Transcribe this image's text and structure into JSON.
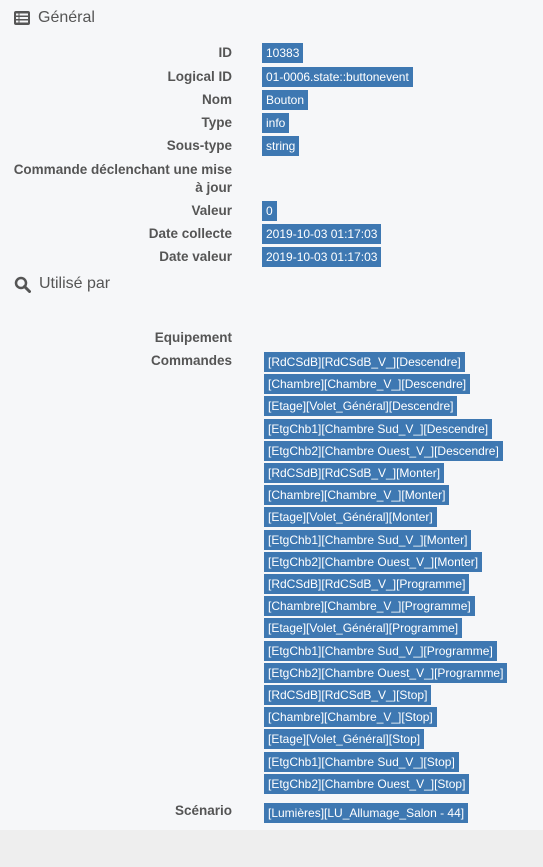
{
  "general": {
    "title": "Général",
    "icon": "list-icon",
    "rows": [
      {
        "label": "ID",
        "value": "10383"
      },
      {
        "label": "Logical ID",
        "value": "01-0006.state::buttonevent"
      },
      {
        "label": "Nom",
        "value": "Bouton"
      },
      {
        "label": "Type",
        "value": "info"
      },
      {
        "label": "Sous-type",
        "value": "string"
      },
      {
        "label": "Commande déclenchant une mise à jour",
        "value": ""
      },
      {
        "label": "Valeur",
        "value": "0"
      },
      {
        "label": "Date collecte",
        "value": "2019-10-03 01:17:03"
      },
      {
        "label": "Date valeur",
        "value": "2019-10-03 01:17:03"
      }
    ]
  },
  "used_by": {
    "title": "Utilisé par",
    "icon": "search-icon",
    "equipement_label": "Equipement",
    "commandes_label": "Commandes",
    "commandes": [
      "[RdCSdB][RdCSdB_V_][Descendre]",
      "[Chambre][Chambre_V_][Descendre]",
      "[Etage][Volet_Général][Descendre]",
      "[EtgChb1][Chambre Sud_V_][Descendre]",
      "[EtgChb2][Chambre Ouest_V_][Descendre]",
      "[RdCSdB][RdCSdB_V_][Monter]",
      "[Chambre][Chambre_V_][Monter]",
      "[Etage][Volet_Général][Monter]",
      "[EtgChb1][Chambre Sud_V_][Monter]",
      "[EtgChb2][Chambre Ouest_V_][Monter]",
      "[RdCSdB][RdCSdB_V_][Programme]",
      "[Chambre][Chambre_V_][Programme]",
      "[Etage][Volet_Général][Programme]",
      "[EtgChb1][Chambre Sud_V_][Programme]",
      "[EtgChb2][Chambre Ouest_V_][Programme]",
      "[RdCSdB][RdCSdB_V_][Stop]",
      "[Chambre][Chambre_V_][Stop]",
      "[Etage][Volet_Général][Stop]",
      "[EtgChb1][Chambre Sud_V_][Stop]",
      "[EtgChb2][Chambre Ouest_V_][Stop]"
    ],
    "scenario_label": "Scénario",
    "scenario": "[Lumières][LU_Allumage_Salon - 44]"
  },
  "colors": {
    "badge_bg": "#3e78b2",
    "badge_text": "#ffffff",
    "label_text": "#555555",
    "panel_bg": "#f6f7f9"
  }
}
